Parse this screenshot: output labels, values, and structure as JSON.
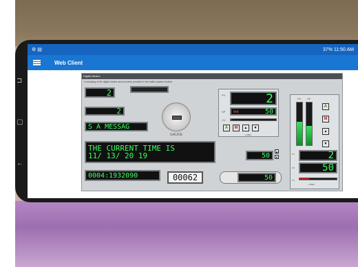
{
  "status": {
    "time": "11:50 AM",
    "battery": "37%"
  },
  "appbar": {
    "title": "Web Client"
  },
  "panel": {
    "title": "Digital Meters",
    "subtitle": "A sampling of the digital meters and counters provided in the builtin system toolbox",
    "lcd1": "2",
    "lcd2": "2",
    "message": "S A MESSAG",
    "time_line1": "THE CURRENT TIME IS",
    "time_line2": "11/ 13/ 20 19",
    "bigcounter": "0004:1932090",
    "odometer": "00062",
    "gauge_label": "GAUGE",
    "pv_value": "2",
    "sp_value": "50",
    "man_label": "MAN",
    "label_small": "LABEL",
    "pv2": "2",
    "sp2": "50",
    "mid_value": "50",
    "bottom_value": "50"
  },
  "controls": {
    "a": "A",
    "m": "M",
    "up": "▲",
    "down": "▼",
    "pv": "PV",
    "sp": "SP",
    "cv": "CV"
  },
  "colors": {
    "lcd_green": "#3cff62",
    "appbar_blue": "#1976d2",
    "status_blue": "#1565c0"
  }
}
